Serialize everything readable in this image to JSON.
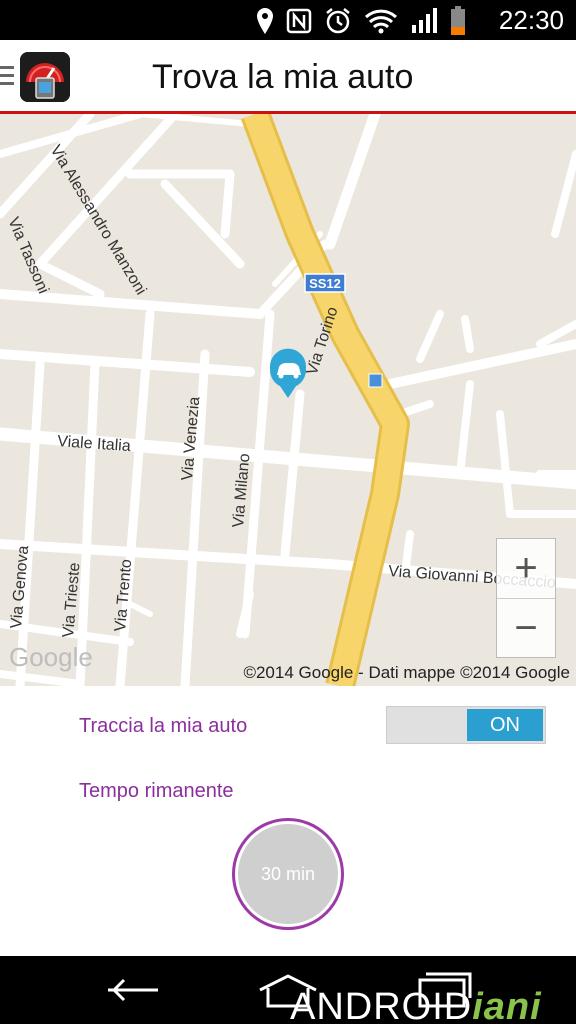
{
  "status": {
    "time": "22:30",
    "icons": [
      "location-icon",
      "nfc-icon",
      "alarm-icon",
      "wifi-icon",
      "signal-icon",
      "battery-icon"
    ]
  },
  "header": {
    "title": "Trova la mia auto",
    "icon": "speedometer-app-icon"
  },
  "map": {
    "streets": {
      "alessandro_manzoni": "Via Alessandro Manzoni",
      "tassoni": "Via Tassoni",
      "ss12": "SS12",
      "torino": "Via Torino",
      "viale_italia": "Viale Italia",
      "venezia": "Via Venezia",
      "milano": "Via Milano",
      "giovanni_boccaccio": "Via Giovanni Boccaccio",
      "genova": "Via Genova",
      "trieste": "Via Trieste",
      "trento": "Via Trento"
    },
    "zoom_in": "+",
    "zoom_out": "−",
    "google_logo": "Google",
    "attribution": "©2014 Google - Dati mappe ©2014 Google",
    "marker_icon": "car-marker-icon"
  },
  "controls": {
    "track_label": "Traccia la mia auto",
    "toggle_state": "ON",
    "time_label": "Tempo rimanente",
    "timer_value": "30 min"
  },
  "navbar": {
    "back": "back-icon",
    "home": "home-icon",
    "recent": "recent-apps-icon"
  },
  "watermark": {
    "part1": "ANDROID",
    "part2": "iani"
  },
  "colors": {
    "accent": "#8b2f9c",
    "toggle": "#2b9fcf",
    "road_major": "#f7d56b",
    "header_line": "#d01010"
  }
}
